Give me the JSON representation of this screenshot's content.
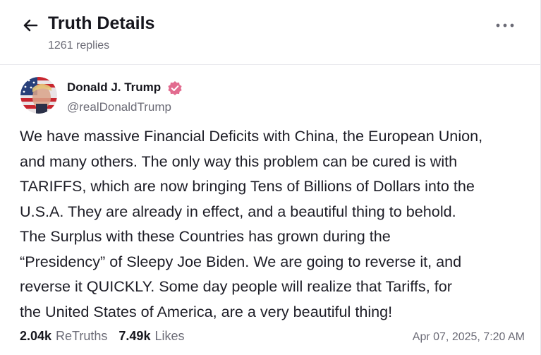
{
  "header": {
    "title": "Truth Details",
    "reply_count": "1261 replies"
  },
  "post": {
    "author_name": "Donald J. Trump",
    "author_handle": "@realDonaldTrump",
    "body": "We have massive Financial Deficits with China, the European Union,\nand many others. The only way this problem can be cured is with\nTARIFFS, which are now bringing Tens of Billions of Dollars into the\nU.S.A. They are already in effect, and a beautiful thing to behold.\nThe Surplus with these Countries has grown during the\n“Presidency” of Sleepy Joe Biden. We are going to reverse it, and\nreverse it QUICKLY. Some day people will realize that Tariffs, for\nthe United States of America, are a very beautiful thing!",
    "retruths_count": "2.04k",
    "retruths_label": "ReTruths",
    "likes_count": "7.49k",
    "likes_label": "Likes",
    "timestamp": "Apr 07, 2025, 7:20 AM"
  },
  "icons": {
    "back": "arrow-left-icon",
    "more": "ellipsis-icon",
    "verified": "verified-badge-icon"
  },
  "colors": {
    "verified_badge": "#e26b8f",
    "muted_text": "#6b6b76",
    "primary_text": "#16161d"
  }
}
